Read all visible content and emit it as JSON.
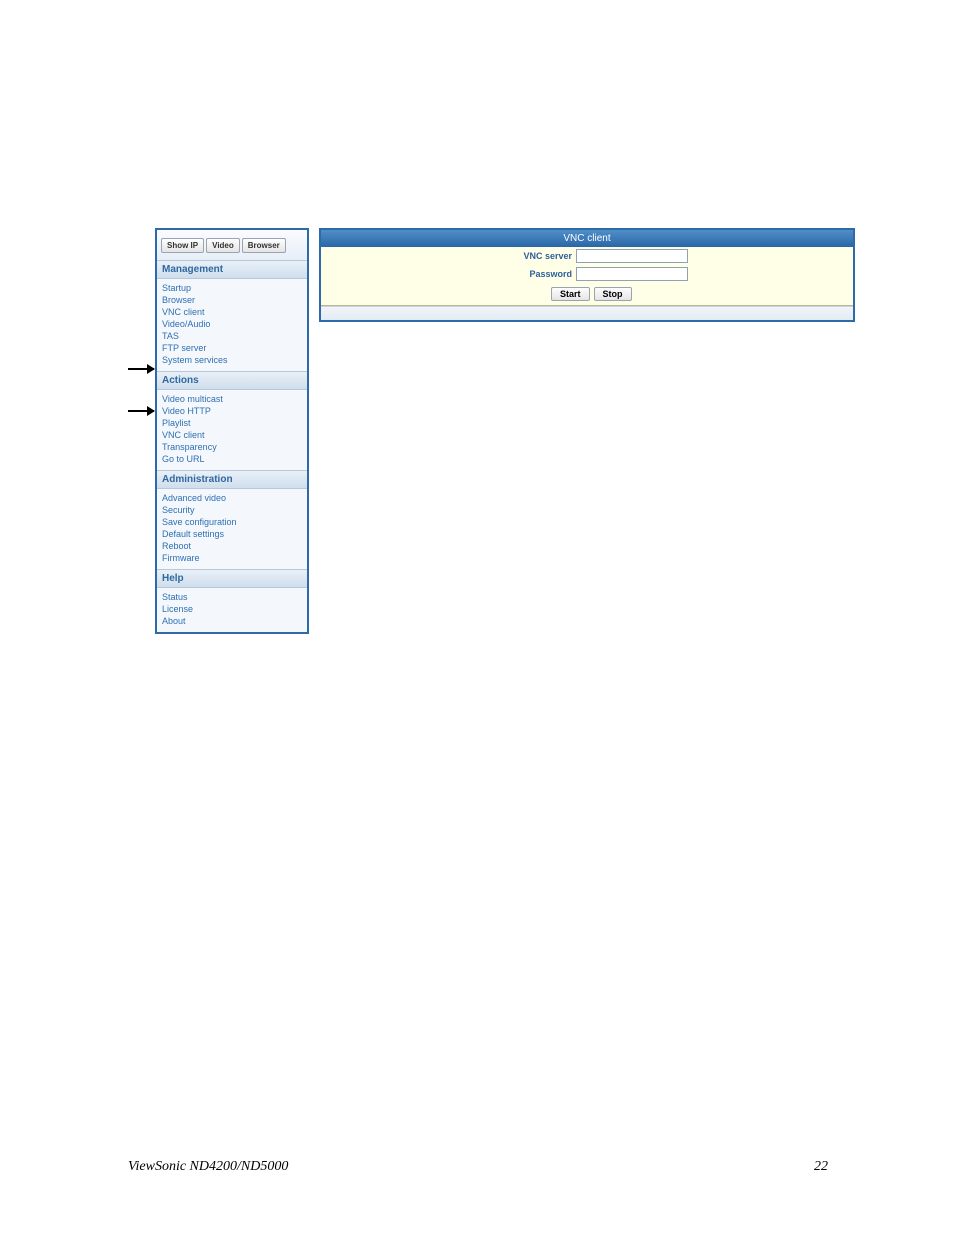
{
  "sidebar": {
    "tabs": {
      "show_ip": "Show IP",
      "video": "Video",
      "browser": "Browser"
    },
    "section_management": "Management",
    "management": [
      "Startup",
      "Browser",
      "VNC client",
      "Video/Audio",
      "TAS",
      "FTP server",
      "System services"
    ],
    "section_actions": "Actions",
    "actions": [
      "Video multicast",
      "Video HTTP",
      "Playlist",
      "VNC client",
      "Transparency",
      "Go to URL"
    ],
    "section_admin": "Administration",
    "admin": [
      "Advanced video",
      "Security",
      "Save configuration",
      "Default settings",
      "Reboot",
      "Firmware"
    ],
    "section_help": "Help",
    "help": [
      "Status",
      "License",
      "About"
    ]
  },
  "main": {
    "title": "VNC client",
    "vnc_server_label": "VNC server",
    "password_label": "Password",
    "vnc_server_value": "",
    "password_value": "",
    "start_label": "Start",
    "stop_label": "Stop"
  },
  "footer": {
    "product": "ViewSonic ND4200/ND5000",
    "page": "22"
  }
}
